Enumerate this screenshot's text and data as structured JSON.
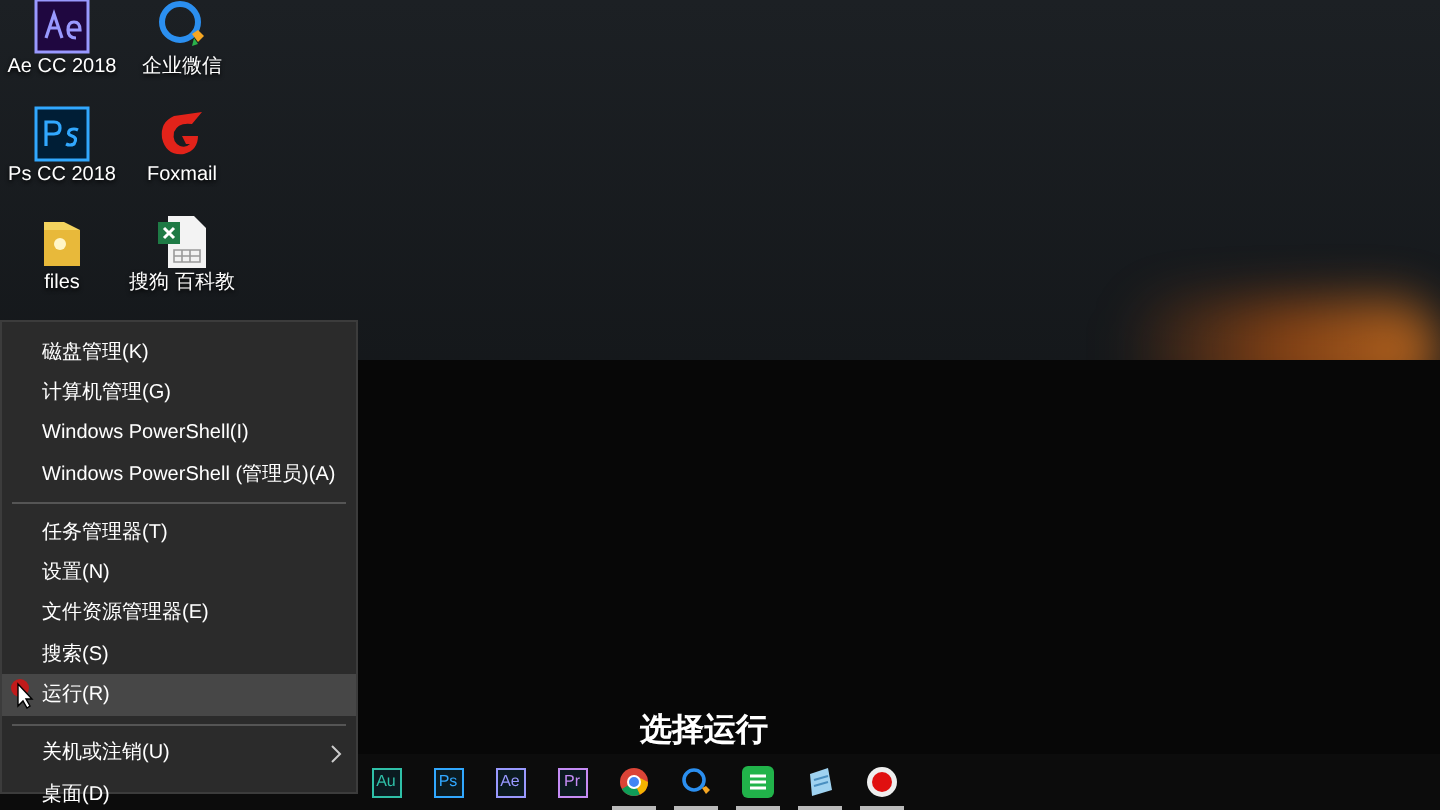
{
  "desktop_icons": [
    {
      "label": "Ae CC 2018",
      "kind": "ae"
    },
    {
      "label": "企业微信",
      "kind": "wecom"
    },
    {
      "label": "Ps CC 2018",
      "kind": "ps"
    },
    {
      "label": "Foxmail",
      "kind": "foxmail"
    },
    {
      "label": "files",
      "kind": "folder"
    },
    {
      "label": "搜狗 百科教",
      "kind": "excel"
    }
  ],
  "context_menu": {
    "groups": [
      [
        {
          "label": "磁盘管理(K)",
          "selected": false,
          "submenu": false
        },
        {
          "label": "计算机管理(G)",
          "selected": false,
          "submenu": false
        },
        {
          "label": "Windows PowerShell(I)",
          "selected": false,
          "submenu": false
        },
        {
          "label": "Windows PowerShell (管理员)(A)",
          "selected": false,
          "submenu": false
        }
      ],
      [
        {
          "label": "任务管理器(T)",
          "selected": false,
          "submenu": false
        },
        {
          "label": "设置(N)",
          "selected": false,
          "submenu": false
        },
        {
          "label": "文件资源管理器(E)",
          "selected": false,
          "submenu": false
        },
        {
          "label": "搜索(S)",
          "selected": false,
          "submenu": false
        },
        {
          "label": "运行(R)",
          "selected": true,
          "submenu": false
        }
      ],
      [
        {
          "label": "关机或注销(U)",
          "selected": false,
          "submenu": true
        },
        {
          "label": "桌面(D)",
          "selected": false,
          "submenu": false
        }
      ]
    ]
  },
  "subtitle": "选择运行",
  "taskbar": [
    {
      "kind": "app",
      "text": "Au",
      "color": "#2fc0a8",
      "running": false
    },
    {
      "kind": "app",
      "text": "Ps",
      "color": "#31a8ff",
      "running": false
    },
    {
      "kind": "app",
      "text": "Ae",
      "color": "#9999ff",
      "running": false
    },
    {
      "kind": "app",
      "text": "Pr",
      "color": "#c58cf5",
      "running": false
    },
    {
      "kind": "chrome",
      "running": true
    },
    {
      "kind": "wecom",
      "running": true
    },
    {
      "kind": "sheet",
      "running": true
    },
    {
      "kind": "notepad",
      "running": true
    },
    {
      "kind": "record",
      "running": true
    }
  ]
}
